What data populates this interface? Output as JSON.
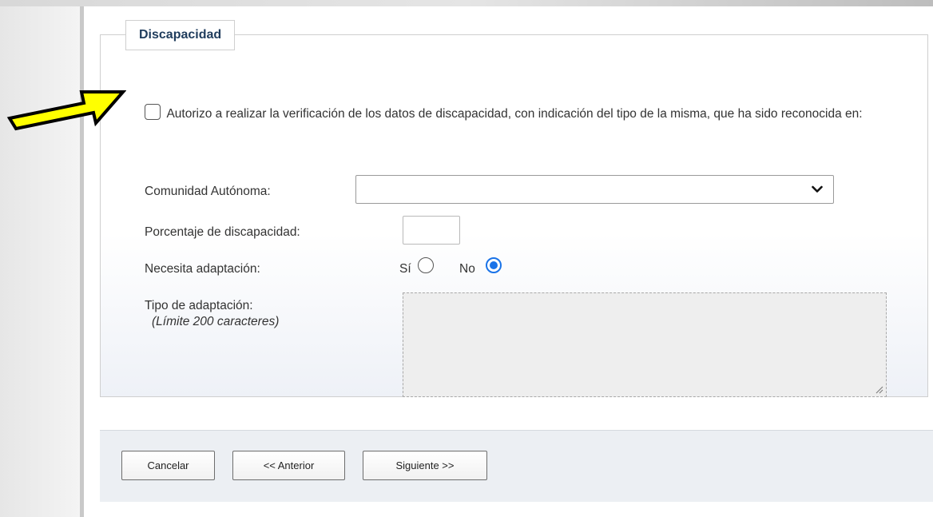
{
  "section": {
    "legend": "Discapacidad",
    "consent_text": "Autorizo a realizar la verificación de los datos de discapacidad, con indicación del tipo de la misma, que ha sido reconocida en:",
    "consent_checked": false
  },
  "form": {
    "comunidad_label": "Comunidad Autónoma:",
    "comunidad_value": "",
    "porcentaje_label": "Porcentaje de discapacidad:",
    "porcentaje_value": "",
    "adaptacion_label": "Necesita adaptación:",
    "adaptacion_options": [
      {
        "label": "Sí",
        "checked": false
      },
      {
        "label": "No",
        "checked": true
      }
    ],
    "tipo_label": "Tipo de adaptación:",
    "tipo_hint": "(Límite 200 caracteres)",
    "tipo_value": ""
  },
  "buttons": {
    "cancel": "Cancelar",
    "previous": "<< Anterior",
    "next": "Siguiente >>"
  },
  "annotation": {
    "arrow_color": "#ffff00"
  },
  "colors": {
    "legend_text": "#1f3c5c",
    "radio_checked": "#1a73e8"
  }
}
